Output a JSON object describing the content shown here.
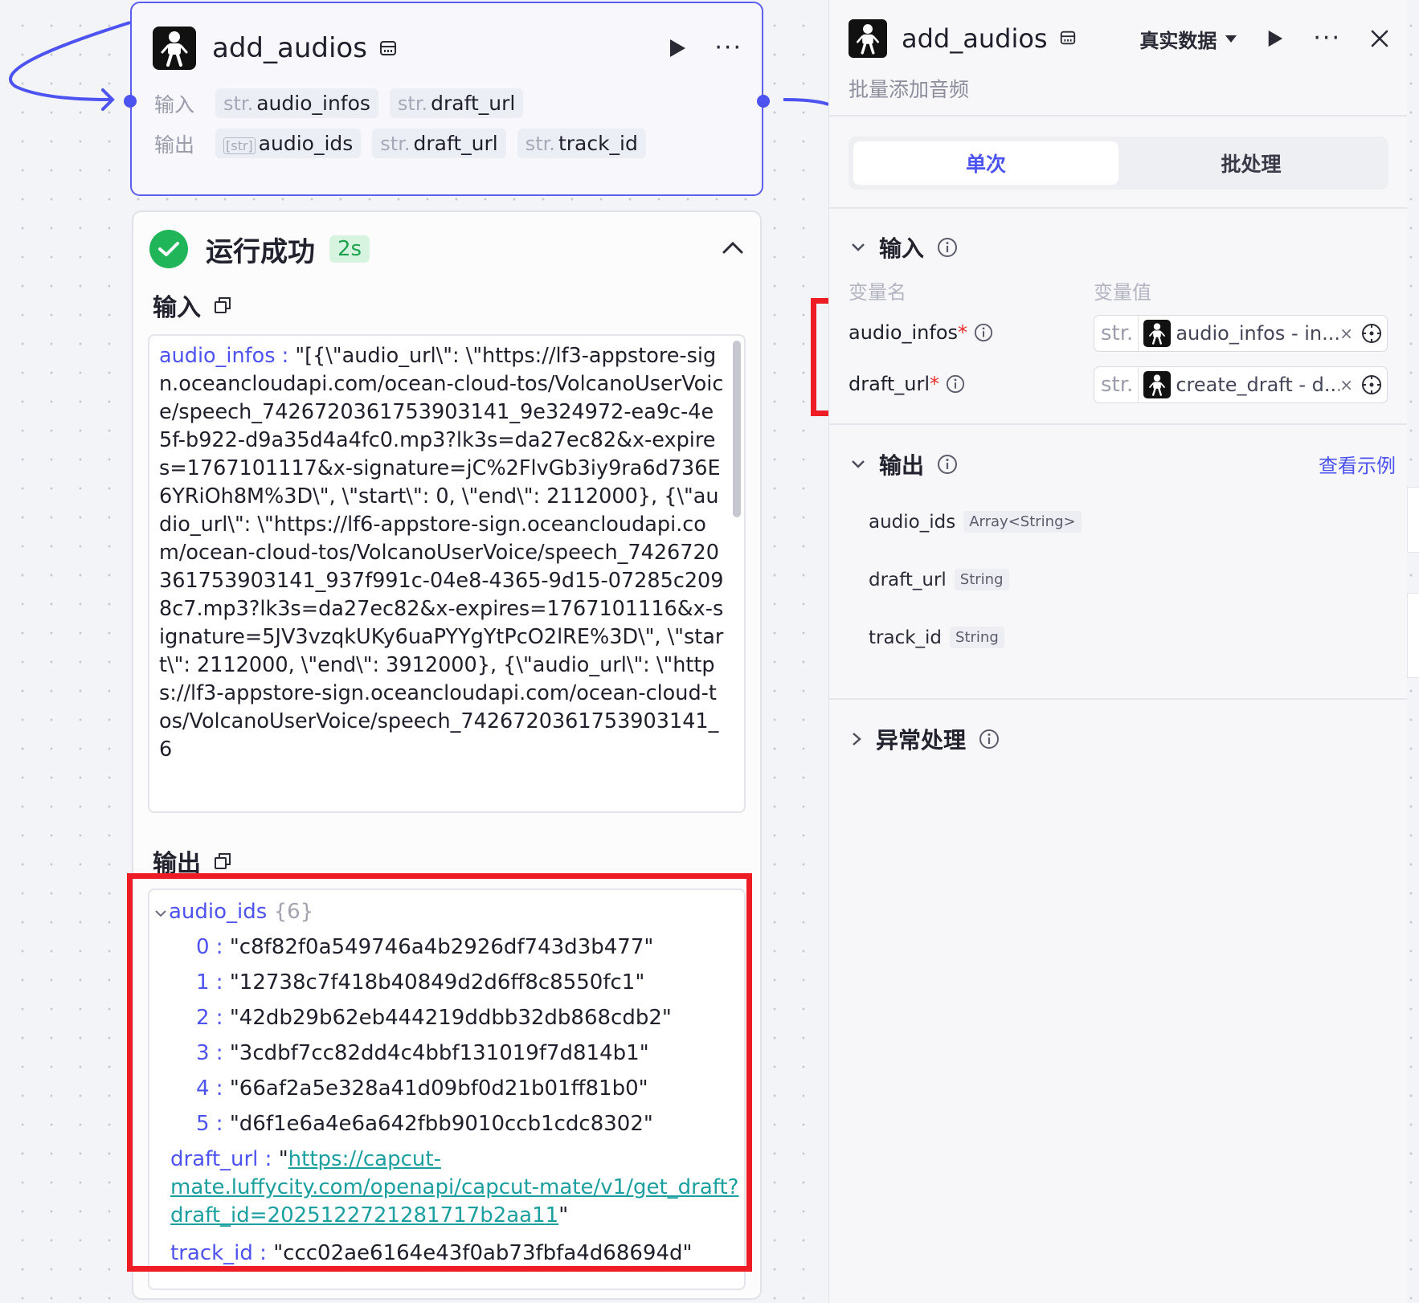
{
  "node": {
    "title": "add_audios",
    "input_label": "输入",
    "output_label": "输出",
    "inputs": [
      {
        "type": "str.",
        "name": "audio_infos"
      },
      {
        "type": "str.",
        "name": "draft_url"
      }
    ],
    "outputs": [
      {
        "type": "[str]",
        "name": "audio_ids"
      },
      {
        "type": "str.",
        "name": "draft_url"
      },
      {
        "type": "str.",
        "name": "track_id"
      }
    ]
  },
  "result": {
    "status": "运行成功",
    "duration": "2s",
    "input_section": "输入",
    "output_section": "输出",
    "input_key": "audio_infos",
    "input_sep": " : ",
    "input_value": "\"[{\\\"audio_url\\\": \\\"https://lf3-appstore-sign.oceancloudapi.com/ocean-cloud-tos/VolcanoUserVoice/speech_7426720361753903141_9e324972-ea9c-4e5f-b922-d9a35d4a4fc0.mp3?lk3s=da27ec82&x-expires=1767101117&x-signature=jC%2FlvGb3iy9ra6d736E6YRiOh8M%3D\\\", \\\"start\\\": 0, \\\"end\\\": 2112000}, {\\\"audio_url\\\": \\\"https://lf6-appstore-sign.oceancloudapi.com/ocean-cloud-tos/VolcanoUserVoice/speech_7426720361753903141_937f991c-04e8-4365-9d15-07285c2098c7.mp3?lk3s=da27ec82&x-expires=1767101116&x-signature=5JV3vzqkUKy6uaPYYgYtPcO2lRE%3D\\\", \\\"start\\\": 2112000, \\\"end\\\": 3912000}, {\\\"audio_url\\\": \\\"https://lf3-appstore-sign.oceancloudapi.com/ocean-cloud-tos/VolcanoUserVoice/speech_7426720361753903141_6",
    "output": {
      "audio_ids_key": "audio_ids",
      "audio_ids_count": "{6}",
      "audio_ids": [
        {
          "idx": "0 :",
          "value": "\"c8f82f0a549746a4b2926df743d3b477\""
        },
        {
          "idx": "1 :",
          "value": "\"12738c7f418b40849d2d6ff8c8550fc1\""
        },
        {
          "idx": "2 :",
          "value": "\"42db29b62eb444219ddbb32db868cdb2\""
        },
        {
          "idx": "3 :",
          "value": "\"3cdbf7cc82dd4c4bbf131019f7d814b1\""
        },
        {
          "idx": "4 :",
          "value": "\"66af2a5e328a41d09bf0d21b01ff81b0\""
        },
        {
          "idx": "5 :",
          "value": "\"d6f1e6a4e6a642fbb9010ccb1cdc8302\""
        }
      ],
      "draft_url_key": "draft_url :",
      "quote_open": "\"",
      "draft_url_line1": "https://capcut-",
      "draft_url_line2": "mate.luffycity.com/openapi/capcut-mate/v1/get_draft?",
      "draft_url_line3": "draft_id=2025122721281717b2aa11",
      "quote_close": "\"",
      "track_id_key": "track_id :",
      "track_id_value": "\"ccc02ae6164e43f0ab73fbfa4d68694d\""
    }
  },
  "side": {
    "title": "add_audios",
    "data_mode": "真实数据",
    "subtitle": "批量添加音频",
    "tabs": [
      "单次",
      "批处理"
    ],
    "input_section": "输入",
    "col_name": "变量名",
    "col_value": "变量值",
    "vars": [
      {
        "name": "audio_infos",
        "req": "*",
        "type": "str.",
        "ref": "audio_infos - in..."
      },
      {
        "name": "draft_url",
        "req": "*",
        "type": "str.",
        "ref": "create_draft - d..."
      }
    ],
    "output_section": "输出",
    "view_example": "查看示例",
    "outputs": [
      {
        "name": "audio_ids",
        "type": "Array<String>"
      },
      {
        "name": "draft_url",
        "type": "String"
      },
      {
        "name": "track_id",
        "type": "String"
      }
    ],
    "exception_section": "异常处理"
  },
  "colors": {
    "accent": "#4d53f0",
    "success": "#21b559",
    "highlight": "#ee1c24",
    "link": "#1b9fa0"
  }
}
